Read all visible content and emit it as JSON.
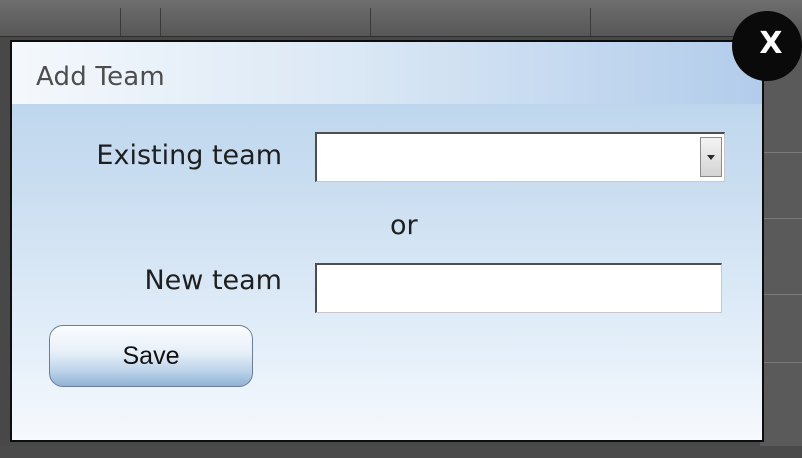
{
  "dialog": {
    "title": "Add Team",
    "close_label": "X",
    "existing_team": {
      "label": "Existing team",
      "selected_value": ""
    },
    "separator_text": "or",
    "new_team": {
      "label": "New team",
      "value": "",
      "placeholder": ""
    },
    "save_label": "Save"
  },
  "colors": {
    "dialog_gradient_top": "#b7d2ec",
    "dialog_gradient_bottom": "#f6f9fd",
    "border": "#0d0d0d",
    "close_button_bg": "#0a0a0a",
    "title_text": "#4e4e4e"
  },
  "icons": {
    "close": "close-icon",
    "dropdown": "chevron-down-icon"
  }
}
